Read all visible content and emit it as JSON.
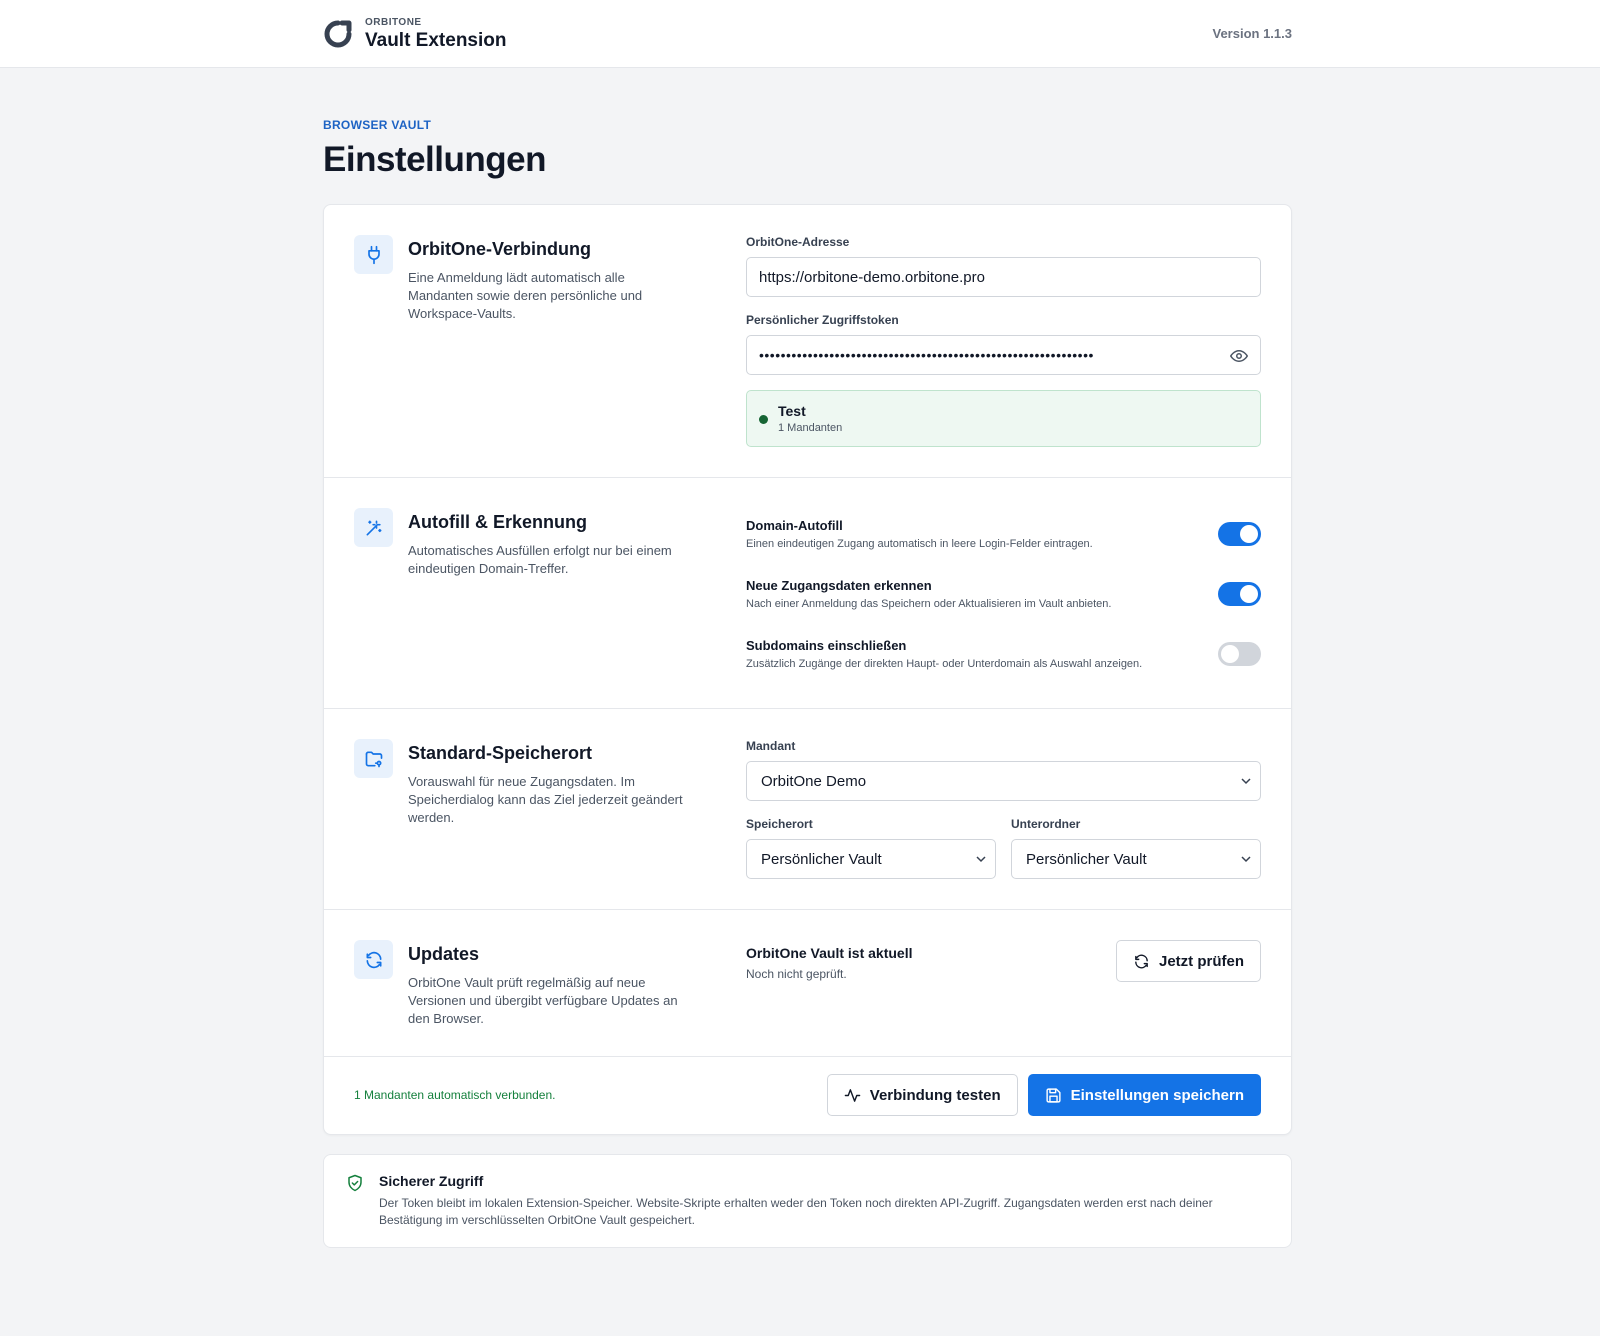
{
  "header": {
    "brand_small": "ORBITONE",
    "brand_name": "Vault Extension",
    "version": "Version 1.1.3"
  },
  "page": {
    "eyebrow": "BROWSER VAULT",
    "title": "Einstellungen"
  },
  "connection": {
    "title": "OrbitOne-Verbindung",
    "description": "Eine Anmeldung lädt automatisch alle Mandanten sowie deren persönliche und Workspace-Vaults.",
    "address_label": "OrbitOne-Adresse",
    "address_value": "https://orbitone-demo.orbitone.pro",
    "token_label": "Persönlicher Zugriffstoken",
    "token_value": "••••••••••••••••••••••••••••••••••••••••••••••••••••••••••••••",
    "status_title": "Test",
    "status_sub": "1 Mandanten",
    "status_color": "#166534"
  },
  "autofill": {
    "title": "Autofill & Erkennung",
    "description": "Automatisches Ausfüllen erfolgt nur bei einem eindeutigen Domain-Treffer.",
    "toggles": [
      {
        "title": "Domain-Autofill",
        "desc": "Einen eindeutigen Zugang automatisch in leere Login-Felder eintragen.",
        "on": true
      },
      {
        "title": "Neue Zugangsdaten erkennen",
        "desc": "Nach einer Anmeldung das Speichern oder Aktualisieren im Vault anbieten.",
        "on": true
      },
      {
        "title": "Subdomains einschließen",
        "desc": "Zusätzlich Zugänge der direkten Haupt- oder Unterdomain als Auswahl anzeigen.",
        "on": false
      }
    ]
  },
  "storage": {
    "title": "Standard-Speicherort",
    "description": "Vorauswahl für neue Zugangsdaten. Im Speicherdialog kann das Ziel jederzeit geändert werden.",
    "tenant_label": "Mandant",
    "tenant_value": "OrbitOne Demo",
    "location_label": "Speicherort",
    "location_value": "Persönlicher Vault",
    "subfolder_label": "Unterordner",
    "subfolder_value": "Persönlicher Vault"
  },
  "updates": {
    "title": "Updates",
    "description": "OrbitOne Vault prüft regelmäßig auf neue Versionen und übergibt verfügbare Updates an den Browser.",
    "status_title": "OrbitOne Vault ist aktuell",
    "status_sub": "Noch nicht geprüft.",
    "check_button": "Jetzt prüfen"
  },
  "footer": {
    "status": "1 Mandanten automatisch verbunden.",
    "test_button": "Verbindung testen",
    "save_button": "Einstellungen speichern"
  },
  "info": {
    "title": "Sicherer Zugriff",
    "text": "Der Token bleibt im lokalen Extension-Speicher. Website-Skripte erhalten weder den Token noch direkten API-Zugriff. Zugangsdaten werden erst nach deiner Bestätigung im verschlüsselten OrbitOne Vault gespeichert."
  },
  "colors": {
    "accent": "#1473e6",
    "accent_light": "#e8f1fc",
    "success": "#15803d",
    "background": "#f3f4f6"
  },
  "icons": {
    "logo": "orbitone-logo-icon",
    "connection": "plug-icon",
    "autofill": "magic-wand-icon",
    "storage": "folder-icon",
    "updates": "refresh-icon",
    "eye": "eye-icon",
    "activity": "activity-icon",
    "save": "save-icon",
    "shield": "shield-check-icon"
  }
}
